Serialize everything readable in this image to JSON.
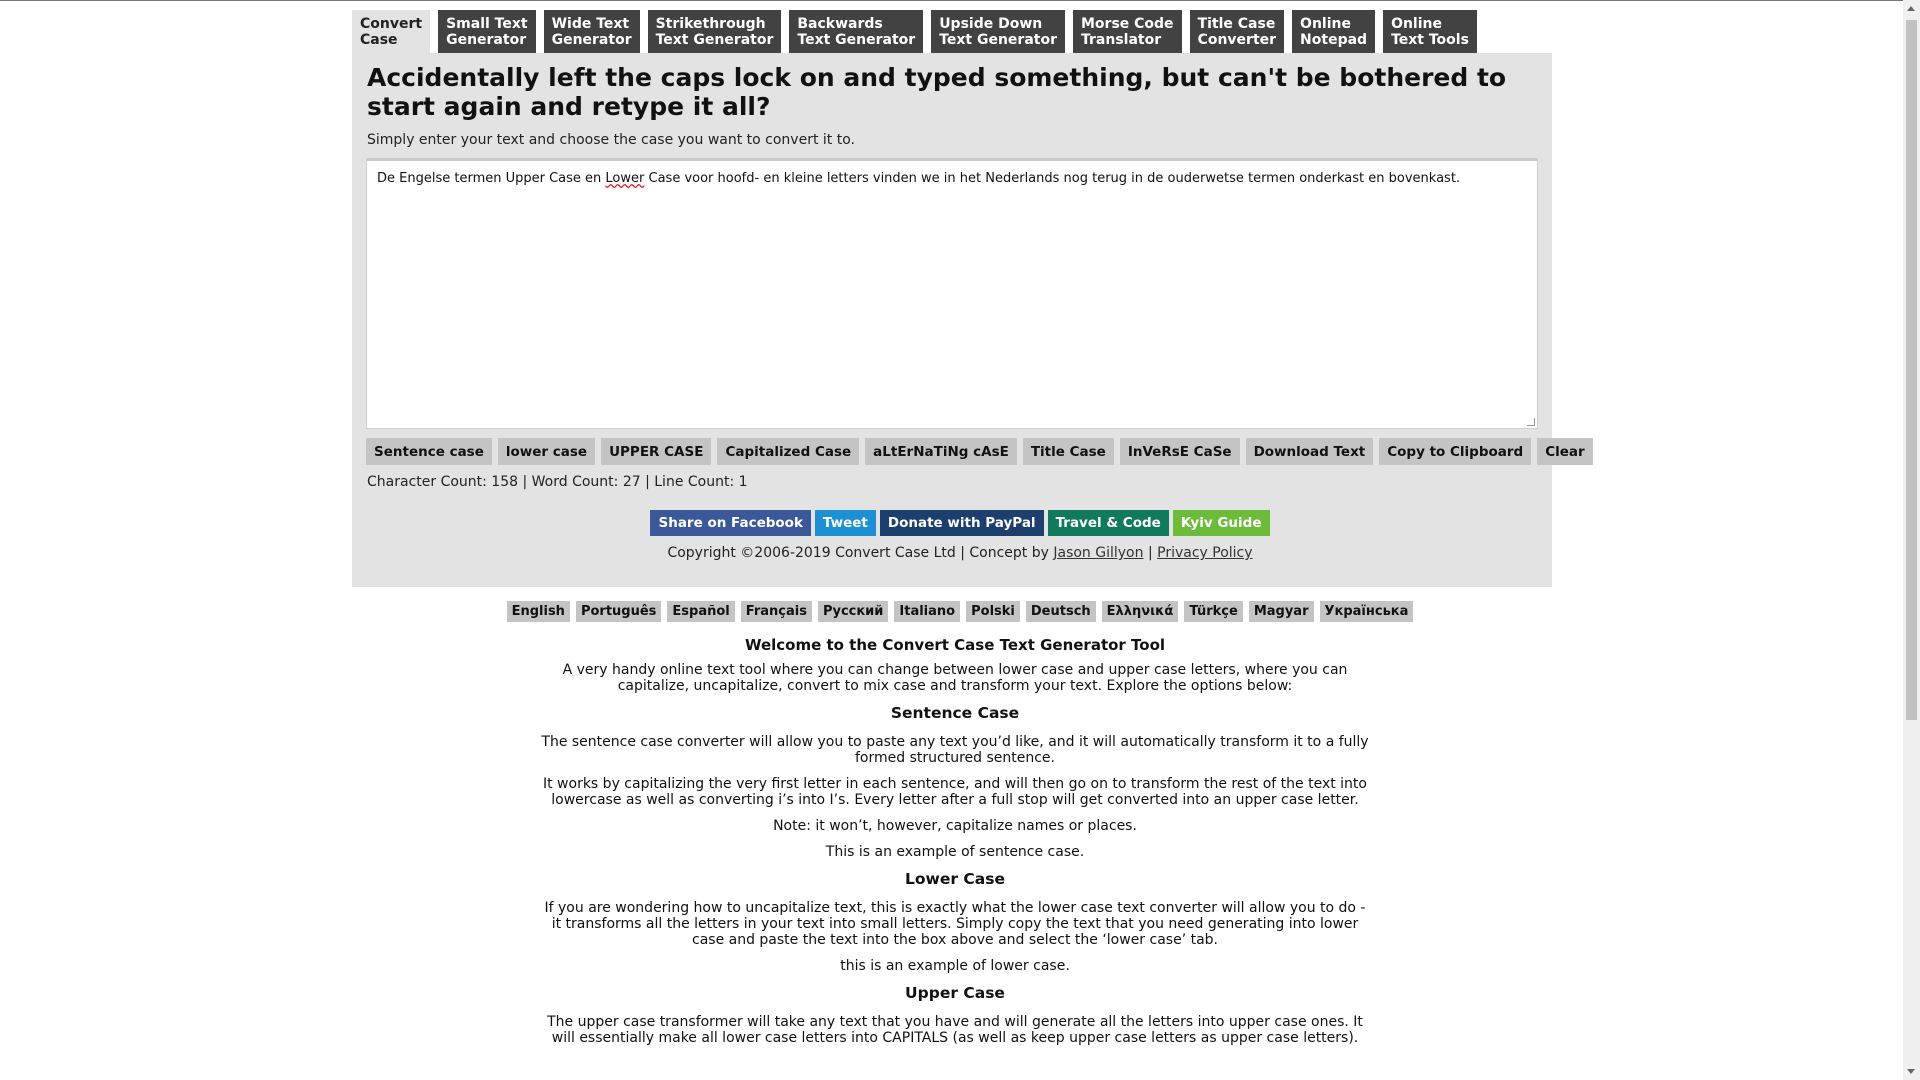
{
  "nav": {
    "tabs": [
      {
        "label1": "Convert",
        "label2": "Case"
      },
      {
        "label1": "Small Text",
        "label2": "Generator"
      },
      {
        "label1": "Wide Text",
        "label2": "Generator"
      },
      {
        "label1": "Strikethrough",
        "label2": "Text Generator"
      },
      {
        "label1": "Backwards",
        "label2": "Text Generator"
      },
      {
        "label1": "Upside Down",
        "label2": "Text Generator"
      },
      {
        "label1": "Morse Code",
        "label2": "Translator"
      },
      {
        "label1": "Title Case",
        "label2": "Converter"
      },
      {
        "label1": "Online",
        "label2": "Notepad"
      },
      {
        "label1": "Online",
        "label2": "Text Tools"
      }
    ]
  },
  "header": {
    "title": "Accidentally left the caps lock on and typed something, but can't be bothered to start again and retype it all?",
    "lead": "Simply enter your text and choose the case you want to convert it to."
  },
  "editor": {
    "before": "De Engelse termen Upper Case en ",
    "misspelled": "Lower",
    "after": " Case voor hoofd- en kleine letters vinden we in het Nederlands nog terug in de ouderwetse termen onderkast en bovenkast."
  },
  "buttons": [
    "Sentence case",
    "lower case",
    "UPPER CASE",
    "Capitalized Case",
    "aLtErNaTiNg cAsE",
    "Title Case",
    "InVeRsE CaSe",
    "Download Text",
    "Copy to Clipboard",
    "Clear"
  ],
  "counts": "Character Count: 158 | Word Count: 27 | Line Count: 1",
  "share": [
    {
      "label": "Share on Facebook",
      "color": "#3b5998"
    },
    {
      "label": "Tweet",
      "color": "#1d8fd3"
    },
    {
      "label": "Donate with PayPal",
      "color": "#1c3f6e"
    },
    {
      "label": "Travel & Code",
      "color": "#117a5c"
    },
    {
      "label": "Kyiv Guide",
      "color": "#6dbb3a"
    }
  ],
  "copyright": {
    "text": "Copyright ©2006-2019 Convert Case Ltd | Concept by ",
    "author": "Jason Gillyon",
    "sep": " | ",
    "privacy": "Privacy Policy"
  },
  "languages": [
    "English",
    "Português",
    "Español",
    "Français",
    "Русский",
    "Italiano",
    "Polski",
    "Deutsch",
    "Ελληνικά",
    "Türkçe",
    "Magyar",
    "Українська"
  ],
  "content": {
    "welcome_title": "Welcome to the Convert Case Text Generator Tool",
    "welcome_text": "A very handy online text tool where you can change between lower case and upper case letters, where you can capitalize, uncapitalize, convert to mix case and transform your text. Explore the options below:",
    "sentence_title": "Sentence Case",
    "sentence_p1": "The sentence case converter will allow you to paste any text you’d like, and it will automatically transform it to a fully formed structured sentence.",
    "sentence_p2": "It works by capitalizing the very first letter in each sentence, and will then go on to transform the rest of the text into lowercase as well as converting i’s into I’s. Every letter after a full stop will get converted into an upper case letter.",
    "sentence_p3": "Note: it won’t, however, capitalize names or places.",
    "sentence_example": "This is an example of sentence case.",
    "lower_title": "Lower Case",
    "lower_p1": "If you are wondering how to uncapitalize text, this is exactly what the lower case text converter will allow you to do - it transforms all the letters in your text into small letters. Simply copy the text that you need generating into lower case and paste the text into the box above and select the ‘lower case’ tab.",
    "lower_example": "this is an example of lower case.",
    "upper_title": "Upper Case",
    "upper_p1": "The upper case transformer will take any text that you have and will generate all the letters into upper case ones. It will essentially make all lower case letters into CAPITALS (as well as keep upper case letters as upper case letters)."
  }
}
